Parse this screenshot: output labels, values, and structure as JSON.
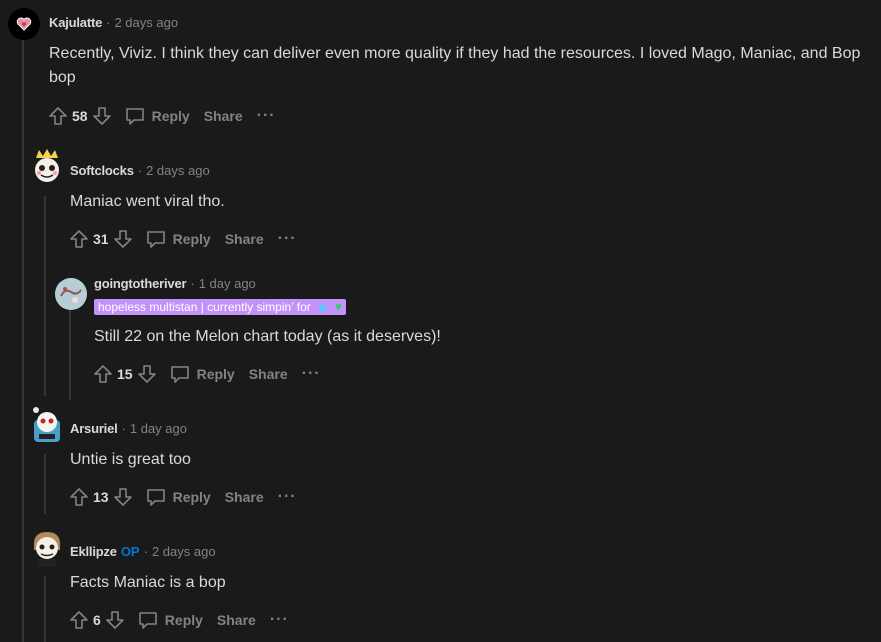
{
  "comments": [
    {
      "author": "Kajulatte",
      "op": "",
      "time": "2 days ago",
      "body": "Recently, Viviz. I think they can deliver even more quality if they had the resources. I loved Mago, Maniac, and Bop bop",
      "score": "58",
      "reply_label": "Reply",
      "share_label": "Share",
      "more_label": "···",
      "avatar_color": "#cc3f5a"
    },
    {
      "author": "Softclocks",
      "op": "",
      "time": "2 days ago",
      "body": "Maniac went viral tho.",
      "score": "31",
      "reply_label": "Reply",
      "share_label": "Share",
      "more_label": "···",
      "avatar_color": "#f6d24a"
    },
    {
      "author": "goingtotheriver",
      "op": "",
      "time": "1 day ago",
      "flair": "hopeless multistan | currently simpin’ for",
      "body": "Still 22 on the Melon chart today (as it deserves)!",
      "score": "15",
      "reply_label": "Reply",
      "share_label": "Share",
      "more_label": "···",
      "avatar_color": "#a9c4d4"
    },
    {
      "author": "Arsuriel",
      "op": "",
      "time": "1 day ago",
      "body": "Untie is great too",
      "score": "13",
      "reply_label": "Reply",
      "share_label": "Share",
      "more_label": "···",
      "avatar_color": "#4a9fc9"
    },
    {
      "author": "Ekllipze",
      "op": "OP",
      "time": "2 days ago",
      "body": "Facts Maniac is a bop",
      "score": "6",
      "reply_label": "Reply",
      "share_label": "Share",
      "more_label": "···",
      "avatar_color": "#b08a58"
    }
  ],
  "colors": {
    "background": "#1a1a1b",
    "text": "#d7dadc",
    "muted": "#818384",
    "thread_line": "#343536",
    "flair_bg": "#c292f9",
    "op_blue": "#0079d3"
  }
}
